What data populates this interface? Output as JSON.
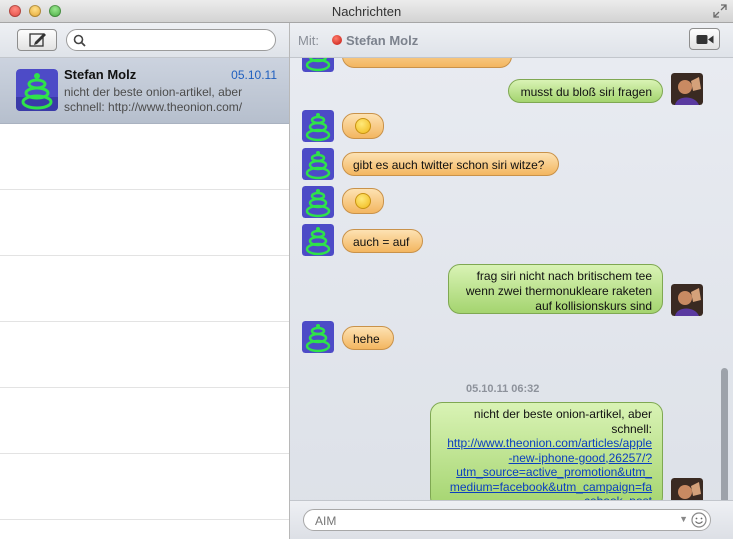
{
  "window": {
    "title": "Nachrichten"
  },
  "sidebar": {
    "search": {
      "placeholder": "",
      "value": ""
    },
    "conversations": [
      {
        "name": "Stefan Molz",
        "date": "05.10.11",
        "preview": "nicht der beste onion-artikel, aber schnell: http://www.theonion.com/"
      }
    ]
  },
  "header": {
    "to_label": "Mit:",
    "recipient": "Stefan Molz",
    "status_color": "#d0231a"
  },
  "messages": [
    {
      "from": "out",
      "text": "musst du bloß siri fragen"
    },
    {
      "from": "in",
      "emoji": "smiley"
    },
    {
      "from": "in",
      "text": "gibt es auch twitter schon siri witze?"
    },
    {
      "from": "in",
      "emoji": "smiley"
    },
    {
      "from": "in",
      "text": "auch = auf"
    },
    {
      "from": "out",
      "text_lines": [
        "frag siri nicht nach britischem tee",
        "wenn zwei thermonukleare raketen",
        "auf kollisionskurs sind"
      ]
    },
    {
      "from": "in",
      "text": "hehe"
    },
    {
      "type": "timestamp",
      "text": "05.10.11 06:32"
    },
    {
      "from": "out",
      "text_lines": [
        "nicht der beste onion-artikel, aber",
        "schnell:"
      ],
      "link_lines": [
        "http://www.theonion.com/articles/apple",
        "-new-iphone-good,26257/?",
        "utm_source=active_promotion&utm_",
        "medium=facebook&utm_campaign=fa",
        "cebook_post"
      ]
    }
  ],
  "input": {
    "placeholder": "AIM"
  },
  "colors": {
    "incoming_bubble": "#f3b660",
    "outgoing_bubble": "#a4d46f",
    "link": "#0b3fbf",
    "date_blue": "#1f5fbf"
  },
  "icons": [
    "compose-icon",
    "search-icon",
    "video-camera-icon",
    "emoji-icon",
    "fullscreen-icon"
  ]
}
